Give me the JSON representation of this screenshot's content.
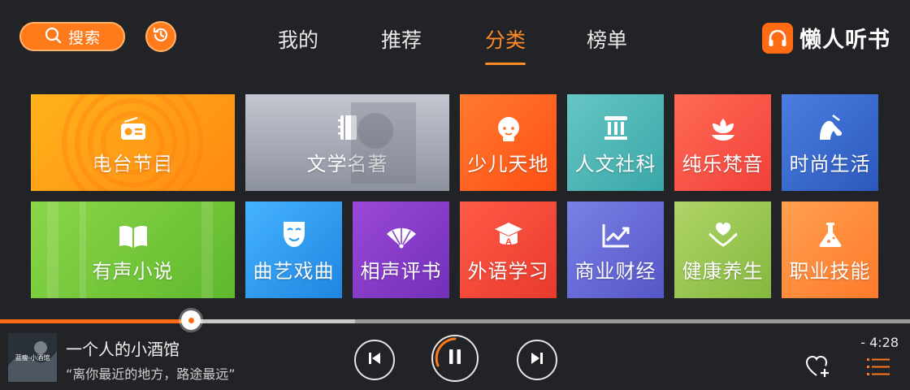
{
  "search": {
    "label": "搜索"
  },
  "tabs": [
    {
      "label": "我的",
      "active": false
    },
    {
      "label": "推荐",
      "active": false
    },
    {
      "label": "分类",
      "active": true
    },
    {
      "label": "榜单",
      "active": false
    }
  ],
  "brand": {
    "name": "懒人听书"
  },
  "categories": [
    {
      "label": "电台节目",
      "icon": "radio-icon",
      "color": "#ff9a1a"
    },
    {
      "label": "文学名著",
      "icon": "book-notebook-icon",
      "color": "#a3a8b3"
    },
    {
      "label": "少儿天地",
      "icon": "child-face-icon",
      "color": "#ff6a1e"
    },
    {
      "label": "人文社科",
      "icon": "pillar-icon",
      "color": "#4fb6b8"
    },
    {
      "label": "纯乐梵音",
      "icon": "lotus-icon",
      "color": "#ff5a47"
    },
    {
      "label": "时尚生活",
      "icon": "high-heel-icon",
      "color": "#3a6fd0"
    },
    {
      "label": "有声小说",
      "icon": "open-book-icon",
      "color": "#7ccf3a"
    },
    {
      "label": "曲艺戏曲",
      "icon": "opera-mask-icon",
      "color": "#2e9ef0"
    },
    {
      "label": "相声评书",
      "icon": "folding-fan-icon",
      "color": "#8a3cc8"
    },
    {
      "label": "外语学习",
      "icon": "graduation-cap-icon",
      "color": "#ff4a3a"
    },
    {
      "label": "商业财经",
      "icon": "line-chart-icon",
      "color": "#6a6ed8"
    },
    {
      "label": "健康养生",
      "icon": "heart-hands-icon",
      "color": "#9ecb5a"
    },
    {
      "label": "职业技能",
      "icon": "flask-icon",
      "color": "#ff8a3a"
    }
  ],
  "player": {
    "title": "一个人的小酒馆",
    "subtitle": "“离你最近的地方，路途最远”",
    "time": "- 4:28",
    "progress": 0.21,
    "buffered": 0.39,
    "cover_text": "蓝瘦·小酒馆"
  },
  "colors": {
    "accent": "#ff7a1a",
    "background": "#222326"
  }
}
